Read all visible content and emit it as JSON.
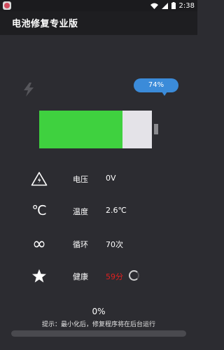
{
  "status_bar": {
    "time": "2:38",
    "icons": [
      "app-badge-icon",
      "wifi-icon",
      "signal-icon",
      "battery-icon"
    ]
  },
  "app": {
    "title": "电池修复专业版"
  },
  "battery": {
    "percent_label": "74%",
    "level": 0.74,
    "fill_color": "#3fd13f",
    "empty_color": "#e4e3e8",
    "charging_icon": "lightning-bolt-icon"
  },
  "stats": [
    {
      "icon": "warning-triangle-icon",
      "label": "电压",
      "value": "0V"
    },
    {
      "icon": "celsius-icon",
      "icon_glyph": "℃",
      "label": "温度",
      "value": "2.6℃"
    },
    {
      "icon": "infinity-icon",
      "icon_glyph": "∞",
      "label": "循环",
      "value": "70次"
    },
    {
      "icon": "star-icon",
      "label": "健康",
      "value": "59分",
      "value_color": "#e02020"
    }
  ],
  "repair": {
    "progress_label": "0%",
    "progress": 0.0,
    "hint": "提示：最小化后，修复程序将在后台运行"
  },
  "colors": {
    "background": "#2c2c31",
    "title_bar": "#1e1e21",
    "accent_blue": "#3b8bd9"
  }
}
